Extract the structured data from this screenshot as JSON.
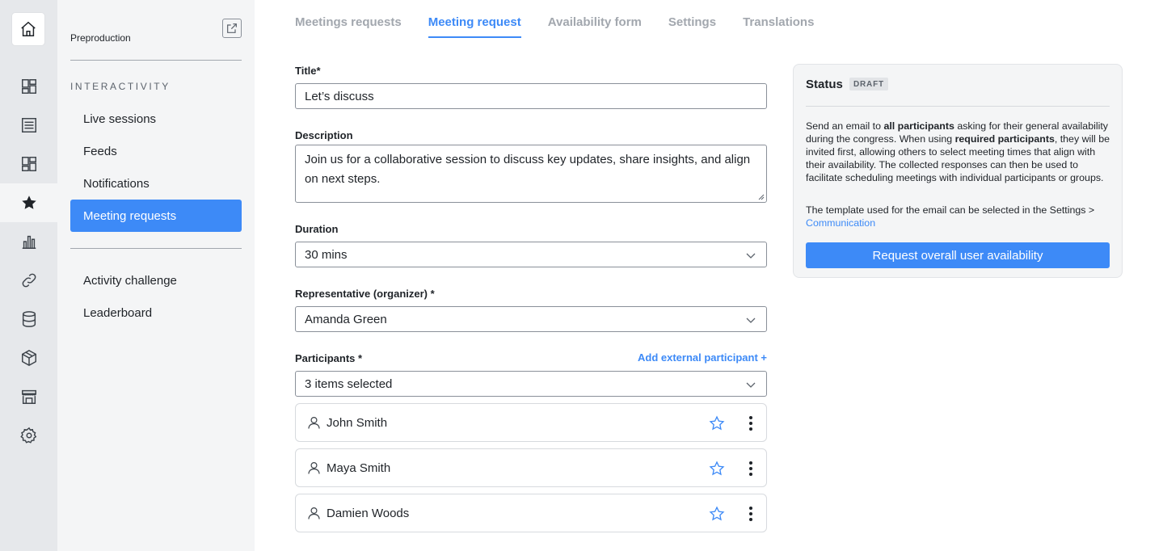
{
  "rail": {
    "items": [
      {
        "icon": "dashboard-icon"
      },
      {
        "icon": "list-icon"
      },
      {
        "icon": "layout-icon"
      },
      {
        "icon": "star-icon"
      },
      {
        "icon": "bar-chart-icon"
      },
      {
        "icon": "link-icon"
      },
      {
        "icon": "database-icon"
      },
      {
        "icon": "package-icon"
      },
      {
        "icon": "store-icon"
      },
      {
        "icon": "gear-icon"
      }
    ]
  },
  "sidebar": {
    "environment": "Preproduction",
    "section_title": "INTERACTIVITY",
    "items": [
      {
        "label": "Live sessions"
      },
      {
        "label": "Feeds"
      },
      {
        "label": "Notifications"
      },
      {
        "label": "Meeting requests",
        "active": true
      }
    ],
    "items_secondary": [
      {
        "label": "Activity challenge"
      },
      {
        "label": "Leaderboard"
      }
    ]
  },
  "tabs": [
    {
      "label": "Meetings requests"
    },
    {
      "label": "Meeting request",
      "active": true
    },
    {
      "label": "Availability form"
    },
    {
      "label": "Settings"
    },
    {
      "label": "Translations"
    }
  ],
  "form": {
    "title_label": "Title*",
    "title_value": "Let’s discuss",
    "description_label": "Description",
    "description_value": "Join us for a collaborative session to discuss key updates, share insights, and align on next steps.",
    "duration_label": "Duration",
    "duration_value": "30 mins",
    "representative_label": "Representative (organizer) *",
    "representative_value": "Amanda Green",
    "participants_label": "Participants *",
    "add_external_label": "Add external participant +",
    "participants_select_value": "3 items selected",
    "participants": [
      {
        "name": "John Smith"
      },
      {
        "name": "Maya Smith"
      },
      {
        "name": "Damien Woods"
      }
    ]
  },
  "status": {
    "title": "Status",
    "badge": "DRAFT",
    "p1_a": "Send an email to ",
    "p1_b": "all participants",
    "p1_c": " asking for their general availability during the congress. When using ",
    "p1_d": "required participants",
    "p1_e": ", they will be invited first, allowing others to select meeting times that align with their availability. The collected responses can then be used to facilitate scheduling meetings with individual participants or groups.",
    "p2_a": "The template used for the email can be selected in the Settings > ",
    "p2_link": "Communication",
    "button_label": "Request overall user availability"
  },
  "colors": {
    "accent": "#3d8af7",
    "rail_bg": "#e6e8eb",
    "sidebar_bg": "#f4f5f6"
  }
}
